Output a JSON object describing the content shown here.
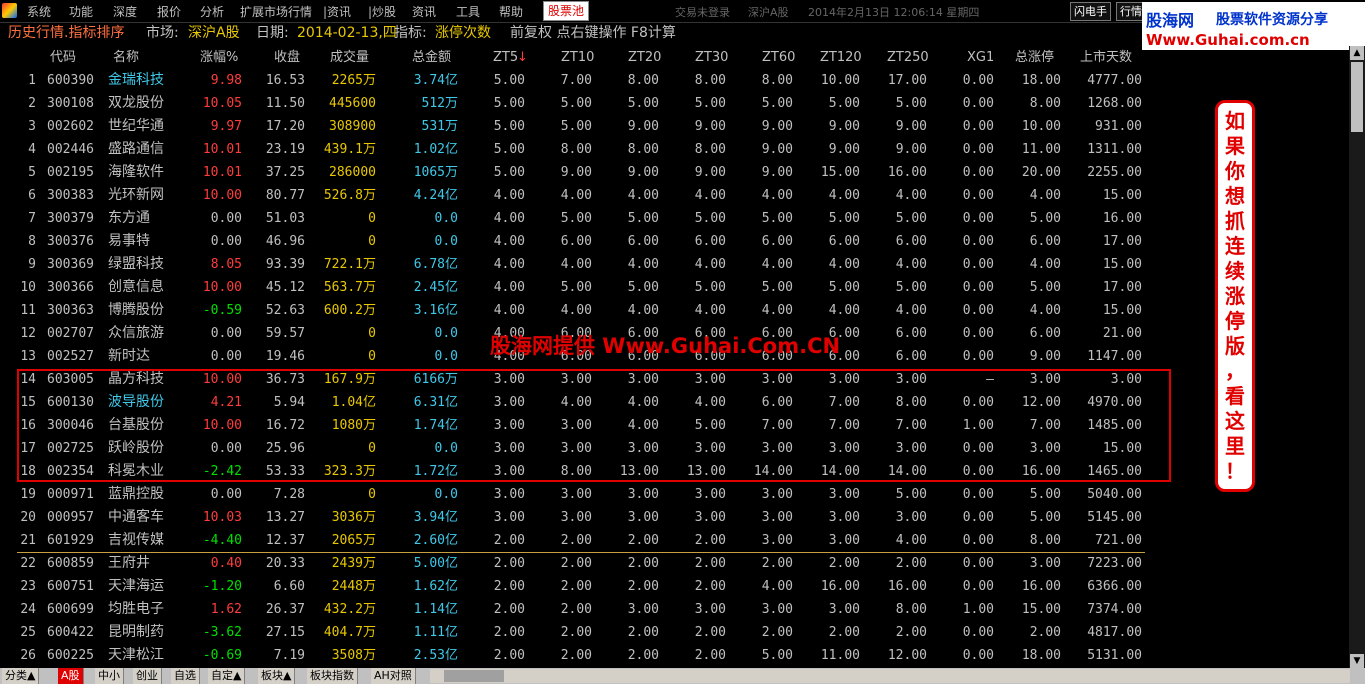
{
  "menubar": {
    "items": [
      "系统",
      "功能",
      "深度",
      "报价",
      "分析",
      "扩展市场行情",
      "|资讯",
      "|炒股",
      "资讯",
      "工具",
      "帮助"
    ],
    "highlight": "股票池",
    "status_trade": "交易未登录",
    "status_market": "深沪A股",
    "status_datetime": "2014年2月13日 12:06:14 星期四",
    "btn_flash": "闪电手",
    "btn_quote": "行情"
  },
  "banner": {
    "logo_cn": "股海网",
    "slogan": "股票软件资源分享",
    "url": "Www.Guhai.com.cn"
  },
  "header": {
    "title": "历史行情.指标排序",
    "market_label": "市场:",
    "market_value": "深沪A股",
    "date_label": "日期:",
    "date_value": "2014-02-13,四",
    "indicator_label": "指标:",
    "indicator_value": "涨停次数",
    "extra": "前复权 点右键操作 F8计算"
  },
  "columns": [
    "代码",
    "名称",
    "涨幅%",
    "收盘",
    "成交量",
    "总金额",
    "ZT5",
    "ZT10",
    "ZT20",
    "ZT30",
    "ZT60",
    "ZT120",
    "ZT250",
    "XG1",
    "总涨停",
    "上市天数"
  ],
  "sort_arrow": "↓",
  "rows": [
    {
      "no": "1",
      "code": "600390",
      "name": "金瑞科技",
      "name_color": "#40c8e8",
      "chg": "9.98",
      "close": "16.53",
      "vol": "2265万",
      "amt": "3.74亿",
      "zt5": "5.00",
      "zt10": "7.00",
      "zt20": "8.00",
      "zt30": "8.00",
      "zt60": "8.00",
      "zt120": "10.00",
      "zt250": "17.00",
      "xg1": "0.00",
      "total": "18.00",
      "days": "4777.00"
    },
    {
      "no": "2",
      "code": "300108",
      "name": "双龙股份",
      "name_color": "#c0c0c0",
      "chg": "10.05",
      "close": "11.50",
      "vol": "445600",
      "amt": "512万",
      "zt5": "5.00",
      "zt10": "5.00",
      "zt20": "5.00",
      "zt30": "5.00",
      "zt60": "5.00",
      "zt120": "5.00",
      "zt250": "5.00",
      "xg1": "0.00",
      "total": "8.00",
      "days": "1268.00"
    },
    {
      "no": "3",
      "code": "002602",
      "name": "世纪华通",
      "name_color": "#c0c0c0",
      "chg": "9.97",
      "close": "17.20",
      "vol": "308900",
      "amt": "531万",
      "zt5": "5.00",
      "zt10": "5.00",
      "zt20": "9.00",
      "zt30": "9.00",
      "zt60": "9.00",
      "zt120": "9.00",
      "zt250": "9.00",
      "xg1": "0.00",
      "total": "10.00",
      "days": "931.00"
    },
    {
      "no": "4",
      "code": "002446",
      "name": "盛路通信",
      "name_color": "#c0c0c0",
      "chg": "10.01",
      "close": "23.19",
      "vol": "439.1万",
      "amt": "1.02亿",
      "zt5": "5.00",
      "zt10": "8.00",
      "zt20": "8.00",
      "zt30": "8.00",
      "zt60": "9.00",
      "zt120": "9.00",
      "zt250": "9.00",
      "xg1": "0.00",
      "total": "11.00",
      "days": "1311.00"
    },
    {
      "no": "5",
      "code": "002195",
      "name": "海隆软件",
      "name_color": "#c0c0c0",
      "chg": "10.01",
      "close": "37.25",
      "vol": "286000",
      "amt": "1065万",
      "zt5": "5.00",
      "zt10": "9.00",
      "zt20": "9.00",
      "zt30": "9.00",
      "zt60": "9.00",
      "zt120": "15.00",
      "zt250": "16.00",
      "xg1": "0.00",
      "total": "20.00",
      "days": "2255.00"
    },
    {
      "no": "6",
      "code": "300383",
      "name": "光环新网",
      "name_color": "#c0c0c0",
      "chg": "10.00",
      "close": "80.77",
      "vol": "526.8万",
      "amt": "4.24亿",
      "zt5": "4.00",
      "zt10": "4.00",
      "zt20": "4.00",
      "zt30": "4.00",
      "zt60": "4.00",
      "zt120": "4.00",
      "zt250": "4.00",
      "xg1": "0.00",
      "total": "4.00",
      "days": "15.00"
    },
    {
      "no": "7",
      "code": "300379",
      "name": "东方通",
      "name_color": "#c0c0c0",
      "chg": "0.00",
      "close": "51.03",
      "vol": "0",
      "amt": "0.0",
      "zt5": "4.00",
      "zt10": "5.00",
      "zt20": "5.00",
      "zt30": "5.00",
      "zt60": "5.00",
      "zt120": "5.00",
      "zt250": "5.00",
      "xg1": "0.00",
      "total": "5.00",
      "days": "16.00"
    },
    {
      "no": "8",
      "code": "300376",
      "name": "易事特",
      "name_color": "#c0c0c0",
      "chg": "0.00",
      "close": "46.96",
      "vol": "0",
      "amt": "0.0",
      "zt5": "4.00",
      "zt10": "6.00",
      "zt20": "6.00",
      "zt30": "6.00",
      "zt60": "6.00",
      "zt120": "6.00",
      "zt250": "6.00",
      "xg1": "0.00",
      "total": "6.00",
      "days": "17.00"
    },
    {
      "no": "9",
      "code": "300369",
      "name": "绿盟科技",
      "name_color": "#c0c0c0",
      "chg": "8.05",
      "close": "93.39",
      "vol": "722.1万",
      "amt": "6.78亿",
      "zt5": "4.00",
      "zt10": "4.00",
      "zt20": "4.00",
      "zt30": "4.00",
      "zt60": "4.00",
      "zt120": "4.00",
      "zt250": "4.00",
      "xg1": "0.00",
      "total": "4.00",
      "days": "15.00"
    },
    {
      "no": "10",
      "code": "300366",
      "name": "创意信息",
      "name_color": "#c0c0c0",
      "chg": "10.00",
      "close": "45.12",
      "vol": "563.7万",
      "amt": "2.45亿",
      "zt5": "4.00",
      "zt10": "5.00",
      "zt20": "5.00",
      "zt30": "5.00",
      "zt60": "5.00",
      "zt120": "5.00",
      "zt250": "5.00",
      "xg1": "0.00",
      "total": "5.00",
      "days": "17.00"
    },
    {
      "no": "11",
      "code": "300363",
      "name": "博腾股份",
      "name_color": "#c0c0c0",
      "chg": "-0.59",
      "close": "52.63",
      "vol": "600.2万",
      "amt": "3.16亿",
      "zt5": "4.00",
      "zt10": "4.00",
      "zt20": "4.00",
      "zt30": "4.00",
      "zt60": "4.00",
      "zt120": "4.00",
      "zt250": "4.00",
      "xg1": "0.00",
      "total": "4.00",
      "days": "15.00"
    },
    {
      "no": "12",
      "code": "002707",
      "name": "众信旅游",
      "name_color": "#c0c0c0",
      "chg": "0.00",
      "close": "59.57",
      "vol": "0",
      "amt": "0.0",
      "zt5": "4.00",
      "zt10": "6.00",
      "zt20": "6.00",
      "zt30": "6.00",
      "zt60": "6.00",
      "zt120": "6.00",
      "zt250": "6.00",
      "xg1": "0.00",
      "total": "6.00",
      "days": "21.00"
    },
    {
      "no": "13",
      "code": "002527",
      "name": "新时达",
      "name_color": "#c0c0c0",
      "chg": "0.00",
      "close": "19.46",
      "vol": "0",
      "amt": "0.0",
      "zt5": "4.00",
      "zt10": "6.00",
      "zt20": "6.00",
      "zt30": "6.00",
      "zt60": "6.00",
      "zt120": "6.00",
      "zt250": "6.00",
      "xg1": "0.00",
      "total": "9.00",
      "days": "1147.00"
    },
    {
      "no": "14",
      "code": "603005",
      "name": "晶方科技",
      "name_color": "#c0c0c0",
      "chg": "10.00",
      "close": "36.73",
      "vol": "167.9万",
      "amt": "6166万",
      "zt5": "3.00",
      "zt10": "3.00",
      "zt20": "3.00",
      "zt30": "3.00",
      "zt60": "3.00",
      "zt120": "3.00",
      "zt250": "3.00",
      "xg1": "—",
      "total": "3.00",
      "days": "3.00"
    },
    {
      "no": "15",
      "code": "600130",
      "name": "波导股份",
      "name_color": "#40c8e8",
      "chg": "4.21",
      "close": "5.94",
      "vol": "1.04亿",
      "amt": "6.31亿",
      "zt5": "3.00",
      "zt10": "4.00",
      "zt20": "4.00",
      "zt30": "4.00",
      "zt60": "6.00",
      "zt120": "7.00",
      "zt250": "8.00",
      "xg1": "0.00",
      "total": "12.00",
      "days": "4970.00"
    },
    {
      "no": "16",
      "code": "300046",
      "name": "台基股份",
      "name_color": "#c0c0c0",
      "chg": "10.00",
      "close": "16.72",
      "vol": "1080万",
      "amt": "1.74亿",
      "zt5": "3.00",
      "zt10": "3.00",
      "zt20": "4.00",
      "zt30": "5.00",
      "zt60": "7.00",
      "zt120": "7.00",
      "zt250": "7.00",
      "xg1": "1.00",
      "total": "7.00",
      "days": "1485.00"
    },
    {
      "no": "17",
      "code": "002725",
      "name": "跃岭股份",
      "name_color": "#c0c0c0",
      "chg": "0.00",
      "close": "25.96",
      "vol": "0",
      "amt": "0.0",
      "zt5": "3.00",
      "zt10": "3.00",
      "zt20": "3.00",
      "zt30": "3.00",
      "zt60": "3.00",
      "zt120": "3.00",
      "zt250": "3.00",
      "xg1": "0.00",
      "total": "3.00",
      "days": "15.00"
    },
    {
      "no": "18",
      "code": "002354",
      "name": "科冕木业",
      "name_color": "#c0c0c0",
      "chg": "-2.42",
      "close": "53.33",
      "vol": "323.3万",
      "amt": "1.72亿",
      "zt5": "3.00",
      "zt10": "8.00",
      "zt20": "13.00",
      "zt30": "13.00",
      "zt60": "14.00",
      "zt120": "14.00",
      "zt250": "14.00",
      "xg1": "0.00",
      "total": "16.00",
      "days": "1465.00"
    },
    {
      "no": "19",
      "code": "000971",
      "name": "蓝鼎控股",
      "name_color": "#c0c0c0",
      "chg": "0.00",
      "close": "7.28",
      "vol": "0",
      "amt": "0.0",
      "zt5": "3.00",
      "zt10": "3.00",
      "zt20": "3.00",
      "zt30": "3.00",
      "zt60": "3.00",
      "zt120": "3.00",
      "zt250": "5.00",
      "xg1": "0.00",
      "total": "5.00",
      "days": "5040.00"
    },
    {
      "no": "20",
      "code": "000957",
      "name": "中通客车",
      "name_color": "#c0c0c0",
      "chg": "10.03",
      "close": "13.27",
      "vol": "3036万",
      "amt": "3.94亿",
      "zt5": "3.00",
      "zt10": "3.00",
      "zt20": "3.00",
      "zt30": "3.00",
      "zt60": "3.00",
      "zt120": "3.00",
      "zt250": "3.00",
      "xg1": "0.00",
      "total": "5.00",
      "days": "5145.00"
    },
    {
      "no": "21",
      "code": "601929",
      "name": "吉视传媒",
      "name_color": "#c0c0c0",
      "chg": "-4.40",
      "close": "12.37",
      "vol": "2065万",
      "amt": "2.60亿",
      "zt5": "2.00",
      "zt10": "2.00",
      "zt20": "2.00",
      "zt30": "2.00",
      "zt60": "3.00",
      "zt120": "3.00",
      "zt250": "4.00",
      "xg1": "0.00",
      "total": "8.00",
      "days": "721.00"
    },
    {
      "no": "22",
      "code": "600859",
      "name": "王府井",
      "name_color": "#c0c0c0",
      "chg": "0.40",
      "close": "20.33",
      "vol": "2439万",
      "amt": "5.00亿",
      "zt5": "2.00",
      "zt10": "2.00",
      "zt20": "2.00",
      "zt30": "2.00",
      "zt60": "2.00",
      "zt120": "2.00",
      "zt250": "2.00",
      "xg1": "0.00",
      "total": "3.00",
      "days": "7223.00"
    },
    {
      "no": "23",
      "code": "600751",
      "name": "天津海运",
      "name_color": "#c0c0c0",
      "chg": "-1.20",
      "close": "6.60",
      "vol": "2448万",
      "amt": "1.62亿",
      "zt5": "2.00",
      "zt10": "2.00",
      "zt20": "2.00",
      "zt30": "2.00",
      "zt60": "4.00",
      "zt120": "16.00",
      "zt250": "16.00",
      "xg1": "0.00",
      "total": "16.00",
      "days": "6366.00"
    },
    {
      "no": "24",
      "code": "600699",
      "name": "均胜电子",
      "name_color": "#c0c0c0",
      "chg": "1.62",
      "close": "26.37",
      "vol": "432.2万",
      "amt": "1.14亿",
      "zt5": "2.00",
      "zt10": "2.00",
      "zt20": "3.00",
      "zt30": "3.00",
      "zt60": "3.00",
      "zt120": "3.00",
      "zt250": "8.00",
      "xg1": "1.00",
      "total": "15.00",
      "days": "7374.00"
    },
    {
      "no": "25",
      "code": "600422",
      "name": "昆明制药",
      "name_color": "#c0c0c0",
      "chg": "-3.62",
      "close": "27.15",
      "vol": "404.7万",
      "amt": "1.11亿",
      "zt5": "2.00",
      "zt10": "2.00",
      "zt20": "2.00",
      "zt30": "2.00",
      "zt60": "2.00",
      "zt120": "2.00",
      "zt250": "2.00",
      "xg1": "0.00",
      "total": "2.00",
      "days": "4817.00"
    },
    {
      "no": "26",
      "code": "600225",
      "name": "天津松江",
      "name_color": "#c0c0c0",
      "chg": "-0.69",
      "close": "7.19",
      "vol": "3508万",
      "amt": "2.53亿",
      "zt5": "2.00",
      "zt10": "2.00",
      "zt20": "2.00",
      "zt30": "2.00",
      "zt60": "5.00",
      "zt120": "11.00",
      "zt250": "12.00",
      "xg1": "0.00",
      "total": "18.00",
      "days": "5131.00"
    }
  ],
  "watermark": "股海网提供 Www.Guhai.Com.CN",
  "promo_text": "如果你想抓连续涨停版，看这里！",
  "tabs": [
    "分类▲",
    "A股",
    "中小",
    "创业",
    "自选",
    "自定▲",
    "板块▲",
    "板块指数",
    "AH对照"
  ],
  "active_tab": "A股",
  "colors": {
    "up": "#ff3c3c",
    "down": "#00e000",
    "flat": "#c0c0c0",
    "vol": "#e8c800",
    "amt": "#40c8e8",
    "highlight_box": "#e00000"
  }
}
